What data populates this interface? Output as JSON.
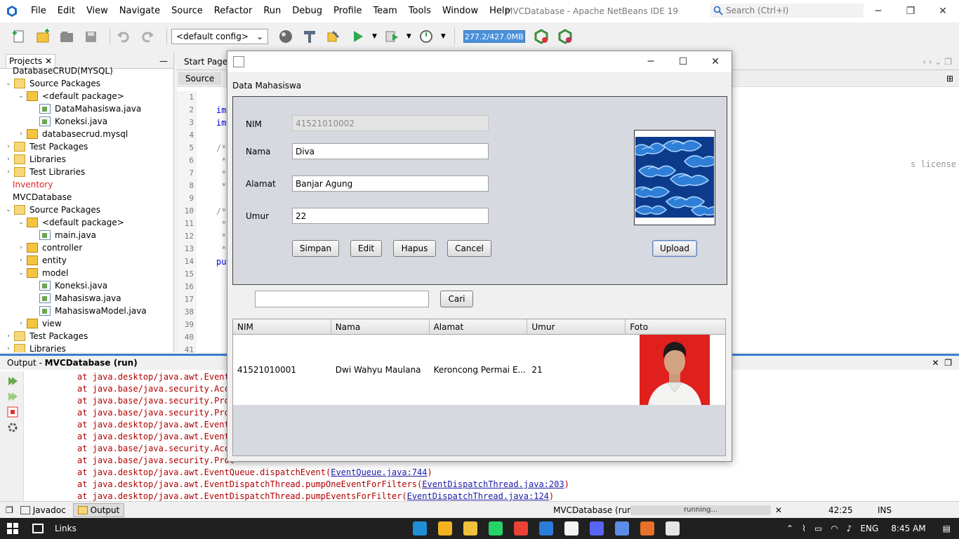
{
  "ide": {
    "menu": [
      "File",
      "Edit",
      "View",
      "Navigate",
      "Source",
      "Refactor",
      "Run",
      "Debug",
      "Profile",
      "Team",
      "Tools",
      "Window",
      "Help"
    ],
    "title": "MVCDatabase - Apache NetBeans IDE 19",
    "search_placeholder": "Search (Ctrl+I)"
  },
  "toolbar": {
    "config": "<default config>",
    "memory": "277.2/427.0MB"
  },
  "projects": {
    "tab": "Projects",
    "items": [
      {
        "label": "DatabaseCRUD(MYSQL)",
        "indent": 0,
        "icon": "none",
        "toggle": ""
      },
      {
        "label": "Source Packages",
        "indent": 0,
        "icon": "folder",
        "toggle": "⌄"
      },
      {
        "label": "<default package>",
        "indent": 1,
        "icon": "pkg",
        "toggle": "⌄"
      },
      {
        "label": "DataMahasiswa.java",
        "indent": 2,
        "icon": "java",
        "toggle": ""
      },
      {
        "label": "Koneksi.java",
        "indent": 2,
        "icon": "java",
        "toggle": ""
      },
      {
        "label": "databasecrud.mysql",
        "indent": 1,
        "icon": "pkg",
        "toggle": "›"
      },
      {
        "label": "Test Packages",
        "indent": 0,
        "icon": "folder",
        "toggle": "›"
      },
      {
        "label": "Libraries",
        "indent": 0,
        "icon": "folder",
        "toggle": "›"
      },
      {
        "label": "Test Libraries",
        "indent": 0,
        "icon": "folder",
        "toggle": "›"
      },
      {
        "label": "Inventory",
        "indent": 0,
        "icon": "none",
        "toggle": "",
        "red": true
      },
      {
        "label": "MVCDatabase",
        "indent": 0,
        "icon": "none",
        "toggle": ""
      },
      {
        "label": "Source Packages",
        "indent": 0,
        "icon": "folder",
        "toggle": "⌄"
      },
      {
        "label": "<default package>",
        "indent": 1,
        "icon": "pkg",
        "toggle": "⌄"
      },
      {
        "label": "main.java",
        "indent": 2,
        "icon": "java",
        "toggle": ""
      },
      {
        "label": "controller",
        "indent": 1,
        "icon": "pkg",
        "toggle": "›"
      },
      {
        "label": "entity",
        "indent": 1,
        "icon": "pkg",
        "toggle": "›"
      },
      {
        "label": "model",
        "indent": 1,
        "icon": "pkg",
        "toggle": "⌄"
      },
      {
        "label": "Koneksi.java",
        "indent": 2,
        "icon": "java",
        "toggle": ""
      },
      {
        "label": "Mahasiswa.java",
        "indent": 2,
        "icon": "java",
        "toggle": ""
      },
      {
        "label": "MahasiswaModel.java",
        "indent": 2,
        "icon": "java",
        "toggle": ""
      },
      {
        "label": "view",
        "indent": 1,
        "icon": "pkg",
        "toggle": "›"
      },
      {
        "label": "Test Packages",
        "indent": 0,
        "icon": "folder",
        "toggle": "›"
      },
      {
        "label": "Libraries",
        "indent": 0,
        "icon": "folder",
        "toggle": "›"
      }
    ]
  },
  "editor": {
    "tabs": [
      "Start Page"
    ],
    "view_tab": "Source",
    "line_numbers": [
      "1",
      "2",
      "3",
      "4",
      "5",
      "6",
      "7",
      "8",
      "9",
      "10",
      "11",
      "12",
      "13",
      "14",
      "15",
      "16",
      "17",
      "38",
      "39",
      "40",
      "41"
    ],
    "code_lines": [
      "",
      "im",
      "im",
      "",
      "/*",
      " *",
      " *",
      " *",
      "",
      "/*",
      " *",
      " *",
      " *",
      "pu",
      "",
      "",
      "",
      "",
      "",
      "",
      ""
    ],
    "license_fragment": "s license"
  },
  "output": {
    "title": "Output - ",
    "title_bold": "MVCDatabase (run)",
    "lines": [
      {
        "text": "at java.desktop/java.awt.Event",
        "link": ""
      },
      {
        "text": "at java.base/java.security.Acce",
        "link": ""
      },
      {
        "text": "at java.base/java.security.Prot",
        "link": ""
      },
      {
        "text": "at java.base/java.security.Prot",
        "link": ""
      },
      {
        "text": "at java.desktop/java.awt.Event",
        "link": ""
      },
      {
        "text": "at java.desktop/java.awt.Event",
        "link": ""
      },
      {
        "text": "at java.base/java.security.Acce",
        "link": ""
      },
      {
        "text": "at java.base/java.security.Prot",
        "link": ""
      },
      {
        "text": "at java.desktop/java.awt.EventQueue.dispatchEvent(",
        "link": "EventQueue.java:744",
        "tail": ")"
      },
      {
        "text": "at java.desktop/java.awt.EventDispatchThread.pumpOneEventForFilters(",
        "link": "EventDispatchThread.java:203",
        "tail": ")"
      },
      {
        "text": "at java.desktop/java.awt.EventDispatchThread.pumpEventsForFilter(",
        "link": "EventDispatchThread.java:124",
        "tail": ")"
      }
    ]
  },
  "statusbar": {
    "javadoc": "Javadoc",
    "output": "Output",
    "project": "MVCDatabase (run)",
    "progress": "running...",
    "position": "42:25",
    "mode": "INS"
  },
  "taskbar": {
    "links": "Links",
    "lang": "ENG",
    "time": "8:45 AM",
    "app_colors": [
      "#1f8fd8",
      "#f3b321",
      "#f2c13b",
      "#25d366",
      "#ea4335",
      "#2b7bd9",
      "#f4f4f4",
      "#5865f2",
      "#5b8de8",
      "#e8702a",
      "#e5e5e5"
    ]
  },
  "dialog": {
    "panel_title": "Data Mahasiswa",
    "labels": {
      "nim": "NIM",
      "nama": "Nama",
      "alamat": "Alamat",
      "umur": "Umur"
    },
    "values": {
      "nim": "41521010002",
      "nama": "Diva",
      "alamat": "Banjar Agung",
      "umur": "22"
    },
    "buttons": {
      "simpan": "Simpan",
      "edit": "Edit",
      "hapus": "Hapus",
      "cancel": "Cancel",
      "upload": "Upload",
      "cari": "Cari"
    },
    "search_value": "",
    "table": {
      "headers": [
        "NIM",
        "Nama",
        "Alamat",
        "Umur",
        "Foto"
      ],
      "rows": [
        {
          "nim": "41521010001",
          "nama": "Dwi Wahyu Maulana",
          "alamat": "Keroncong Permai E...",
          "umur": "21"
        }
      ]
    }
  }
}
